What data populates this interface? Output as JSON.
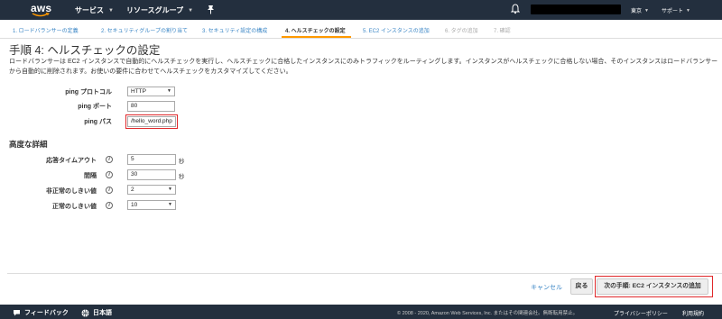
{
  "topnav": {
    "logo": "aws",
    "services": "サービス",
    "resource_groups": "リソースグループ",
    "region": "東京",
    "support": "サポート"
  },
  "steps": [
    {
      "label": "1. ロードバランサーの定義",
      "state": "done"
    },
    {
      "label": "2. セキュリティグループの割り当て",
      "state": "done"
    },
    {
      "label": "3. セキュリティ設定の構成",
      "state": "done"
    },
    {
      "label": "4. ヘルスチェックの設定",
      "state": "active"
    },
    {
      "label": "5. EC2 インスタンスの追加",
      "state": "done"
    },
    {
      "label": "6. タグの追加",
      "state": "future"
    },
    {
      "label": "7. 確認",
      "state": "future"
    }
  ],
  "page": {
    "title": "手順 4: ヘルスチェックの設定",
    "description": "ロードバランサーは EC2 インスタンスで自動的にヘルスチェックを実行し、ヘルスチェックに合格したインスタンスにのみトラフィックをルーティングします。インスタンスがヘルスチェックに合格しない場合、そのインスタンスはロードバランサーから自動的に削除されます。お使いの要件に合わせてヘルスチェックをカスタマイズしてください。"
  },
  "ping": {
    "protocol_label": "ping プロトコル",
    "protocol_value": "HTTP",
    "port_label": "ping ポート",
    "port_value": "80",
    "path_label": "ping パス",
    "path_value": "/hello_word.php"
  },
  "advanced": {
    "title": "高度な詳細",
    "timeout_label": "応答タイムアウト",
    "timeout_value": "5",
    "timeout_unit": "秒",
    "interval_label": "間隔",
    "interval_value": "30",
    "interval_unit": "秒",
    "unhealthy_label": "非正常のしきい値",
    "unhealthy_value": "2",
    "healthy_label": "正常のしきい値",
    "healthy_value": "10"
  },
  "actions": {
    "cancel": "キャンセル",
    "back": "戻る",
    "next": "次の手順: EC2 インスタンスの追加"
  },
  "footer": {
    "feedback": "フィードバック",
    "language": "日本語",
    "copyright": "© 2008 - 2020, Amazon Web Services, Inc. またはその関連会社。無断転用禁止。",
    "privacy": "プライバシーポリシー",
    "terms": "利用規約"
  },
  "colors": {
    "nav_bg": "#232f3e",
    "link": "#3c87c6",
    "accent": "#ff9900",
    "highlight": "#e0292b"
  }
}
